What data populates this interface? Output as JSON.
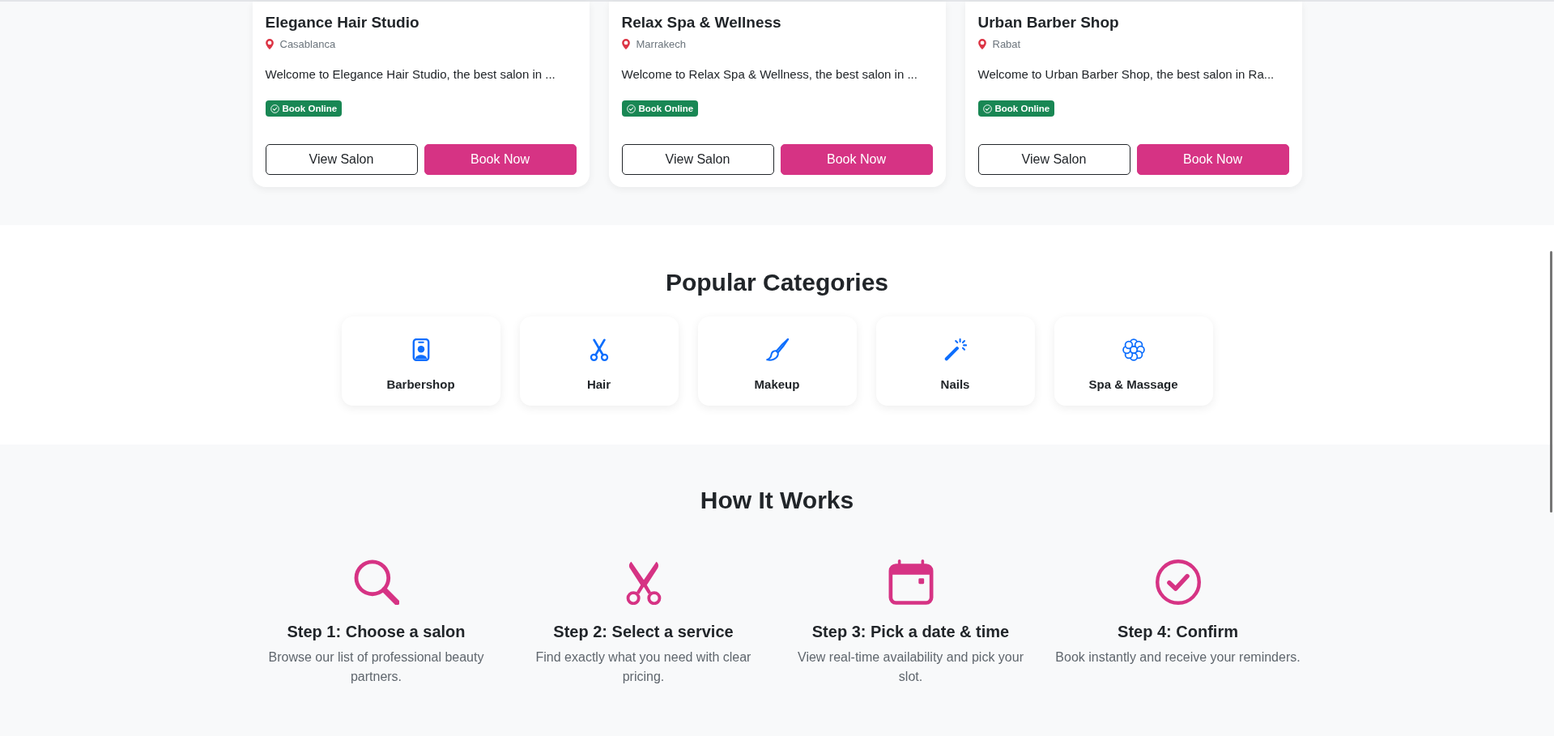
{
  "salons": [
    {
      "name": "Elegance Hair Studio",
      "city": "Casablanca",
      "description": "Welcome to Elegance Hair Studio, the best salon in ...",
      "badge": "Book Online",
      "view_button": "View Salon",
      "book_button": "Book Now"
    },
    {
      "name": "Relax Spa & Wellness",
      "city": "Marrakech",
      "description": "Welcome to Relax Spa & Wellness, the best salon in ...",
      "badge": "Book Online",
      "view_button": "View Salon",
      "book_button": "Book Now"
    },
    {
      "name": "Urban Barber Shop",
      "city": "Rabat",
      "description": "Welcome to Urban Barber Shop, the best salon in Ra...",
      "badge": "Book Online",
      "view_button": "View Salon",
      "book_button": "Book Now"
    }
  ],
  "categories": {
    "title": "Popular Categories",
    "items": [
      {
        "label": "Barbershop"
      },
      {
        "label": "Hair"
      },
      {
        "label": "Makeup"
      },
      {
        "label": "Nails"
      },
      {
        "label": "Spa & Massage"
      }
    ]
  },
  "how_it_works": {
    "title": "How It Works",
    "steps": [
      {
        "title": "Step 1: Choose a salon",
        "text": "Browse our list of professional beauty partners."
      },
      {
        "title": "Step 2: Select a service",
        "text": "Find exactly what you need with clear pricing."
      },
      {
        "title": "Step 3: Pick a date & time",
        "text": "View real-time availability and pick your slot."
      },
      {
        "title": "Step 4: Confirm",
        "text": "Book instantly and receive your reminders."
      }
    ]
  }
}
